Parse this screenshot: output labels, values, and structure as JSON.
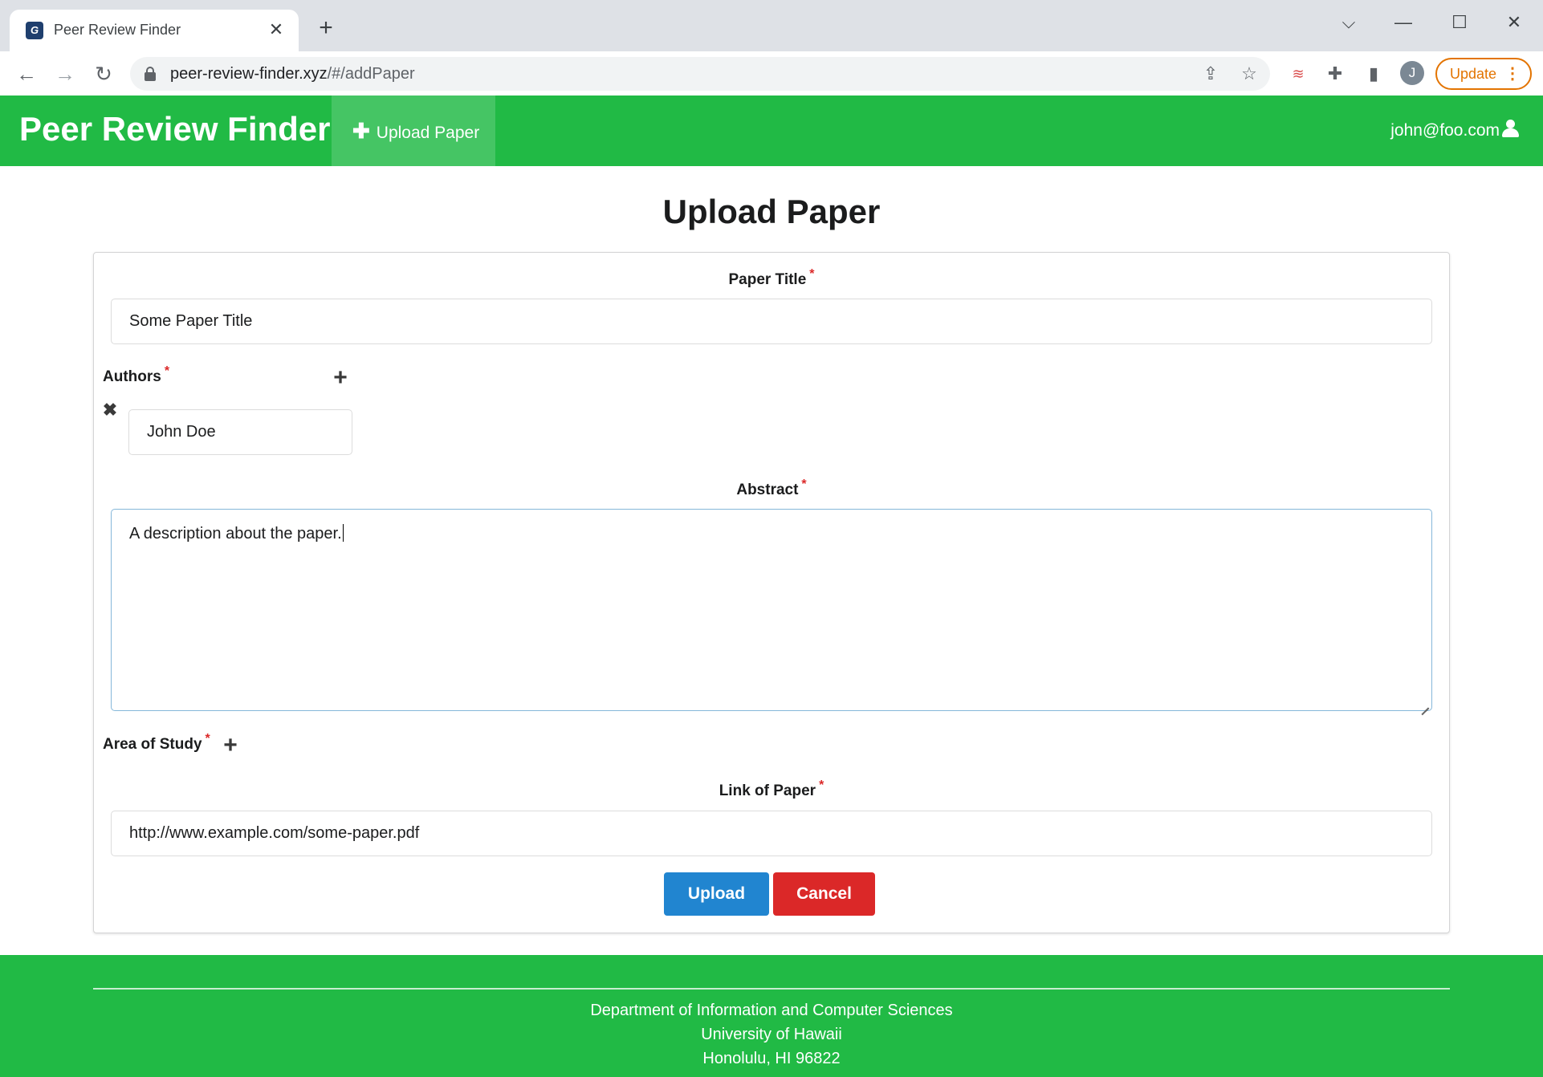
{
  "browser": {
    "tab_title": "Peer Review Finder",
    "favicon_letter": "G",
    "url_host": "peer-review-finder.xyz",
    "url_path": "/#/addPaper",
    "profile_initial": "J",
    "update_label": "Update"
  },
  "nav": {
    "brand": "Peer Review Finder",
    "upload_label": "Upload Paper",
    "user_email": "john@foo.com"
  },
  "form": {
    "page_title": "Upload Paper",
    "required_marker": "*",
    "paper_title": {
      "label": "Paper Title",
      "value": "Some Paper Title"
    },
    "authors": {
      "label": "Authors",
      "items": [
        "John Doe"
      ]
    },
    "abstract": {
      "label": "Abstract",
      "value": "A description about the paper."
    },
    "area_of_study": {
      "label": "Area of Study"
    },
    "link": {
      "label": "Link of Paper",
      "value": "http://www.example.com/some-paper.pdf"
    },
    "upload_button": "Upload",
    "cancel_button": "Cancel"
  },
  "footer": {
    "line1": "Department of Information and Computer Sciences",
    "line2": "University of Hawaii",
    "line3": "Honolulu, HI 96822"
  },
  "colors": {
    "nav_green": "#21ba45",
    "nav_active": "#45c564",
    "upload_blue": "#2185d0",
    "cancel_red": "#db2828",
    "update_orange": "#e37400"
  },
  "icons": {
    "tab_close": "close-icon",
    "new_tab": "plus-icon",
    "back": "back-arrow-icon",
    "forward": "forward-arrow-icon",
    "reload": "reload-icon",
    "share": "share-icon",
    "bookmark": "star-icon",
    "extensions": "puzzle-icon",
    "side_panel": "side-panel-icon",
    "user": "user-icon",
    "add": "plus-icon",
    "remove": "x-icon"
  }
}
